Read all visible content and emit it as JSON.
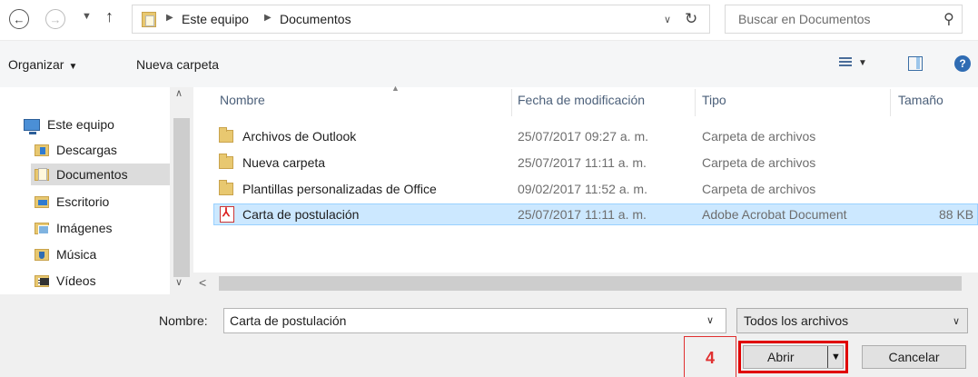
{
  "address": {
    "breadcrumbs": [
      "Este equipo",
      "Documentos"
    ],
    "search_placeholder": "Buscar en Documentos"
  },
  "toolbar": {
    "organize_label": "Organizar",
    "new_folder_label": "Nueva carpeta",
    "help_label": "?"
  },
  "nav": {
    "items": [
      {
        "label": "Este equipo",
        "icon": "computer-icon"
      },
      {
        "label": "Descargas",
        "icon": "downloads-folder-icon"
      },
      {
        "label": "Documentos",
        "icon": "documents-folder-icon",
        "selected": true
      },
      {
        "label": "Escritorio",
        "icon": "desktop-folder-icon"
      },
      {
        "label": "Imágenes",
        "icon": "pictures-folder-icon"
      },
      {
        "label": "Música",
        "icon": "music-folder-icon"
      },
      {
        "label": "Vídeos",
        "icon": "videos-folder-icon"
      }
    ]
  },
  "columns": [
    "Nombre",
    "Fecha de modificación",
    "Tipo",
    "Tamaño"
  ],
  "files": [
    {
      "name": "Archivos de Outlook",
      "date": "25/07/2017 09:27 a. m.",
      "type": "Carpeta de archivos",
      "size": "",
      "icon": "folder-icon"
    },
    {
      "name": "Nueva carpeta",
      "date": "25/07/2017 11:11 a. m.",
      "type": "Carpeta de archivos",
      "size": "",
      "icon": "folder-icon"
    },
    {
      "name": "Plantillas personalizadas de Office",
      "date": "09/02/2017 11:52 a. m.",
      "type": "Carpeta de archivos",
      "size": "",
      "icon": "folder-icon"
    },
    {
      "name": "Carta de postulación",
      "date": "25/07/2017 11:11 a. m.",
      "type": "Adobe Acrobat Document",
      "size": "88 KB",
      "icon": "pdf-icon",
      "selected": true
    }
  ],
  "footer": {
    "name_label": "Nombre:",
    "name_value": "Carta de postulación",
    "filter_value": "Todos los archivos",
    "open_label": "Abrir",
    "cancel_label": "Cancelar",
    "callout_number": "4"
  },
  "colors": {
    "accent_red": "#e00000",
    "selection": "#cce8ff"
  }
}
